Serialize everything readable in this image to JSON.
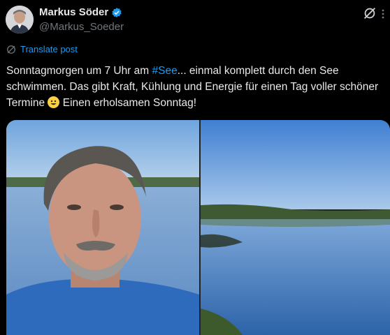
{
  "author": {
    "name": "Markus Söder",
    "handle": "@Markus_Soeder",
    "verified_icon": "verified-badge-icon",
    "avatar_icon": "avatar"
  },
  "actions": {
    "translate_label": "Translate post",
    "grok_icon": "grok-icon",
    "translate_icon": "globe-icon"
  },
  "post": {
    "text_part1": "Sonntagmorgen um 7 Uhr am ",
    "hashtag": "#See",
    "text_part2": "... einmal komplett durch den See schwimmen. Das gibt Kraft, Kühlung und Energie für einen Tag voller schöner Termine ",
    "emoji": "grinning-face-emoji",
    "text_part3": " Einen erholsamen Sonntag!"
  },
  "media": [
    {
      "name": "selfie-photo",
      "description_icon": "photo"
    },
    {
      "name": "lake-photo",
      "description_icon": "photo"
    }
  ],
  "colors": {
    "background": "#000000",
    "text": "#e7e9ea",
    "secondary": "#71767b",
    "accent": "#1d9bf0",
    "verified": "#1d9bf0"
  }
}
